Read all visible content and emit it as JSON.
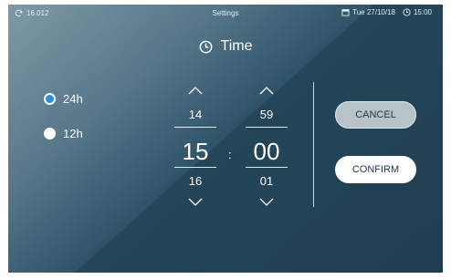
{
  "status_bar": {
    "value": "16.012",
    "title": "Settings",
    "date": "Tue 27/10/18",
    "time": "15:00",
    "icons": [
      "refresh-icon",
      "calendar-icon",
      "clock-icon"
    ]
  },
  "title": {
    "text": "Time",
    "icon": "clock-icon"
  },
  "format_options": [
    {
      "label": "24h",
      "selected": true
    },
    {
      "label": "12h",
      "selected": false
    }
  ],
  "picker": {
    "hours": {
      "prev": "14",
      "current": "15",
      "next": "16"
    },
    "separator": ":",
    "minutes": {
      "prev": "59",
      "current": "00",
      "next": "01"
    }
  },
  "buttons": {
    "cancel": "CANCEL",
    "confirm": "CONFIRM"
  },
  "colors": {
    "accent": "#2a8fd8",
    "background_dark": "#1f3d50",
    "background_light": "#7e9aa6"
  }
}
